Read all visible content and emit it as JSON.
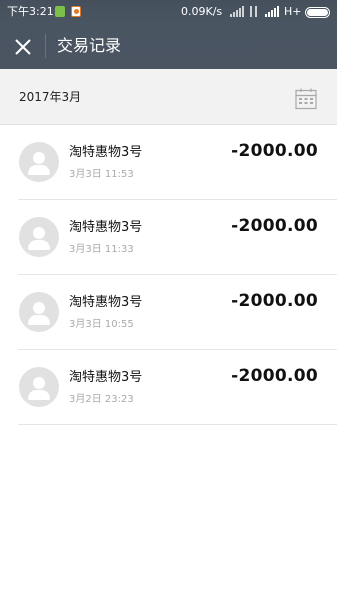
{
  "status_bar": {
    "time": "下午3:21",
    "network_speed": "0.09K/s",
    "network_type": "H+"
  },
  "header": {
    "title": "交易记录"
  },
  "month_bar": {
    "label": "2017年3月"
  },
  "transactions": [
    {
      "name": "淘特惠物3号",
      "date": "3月3日 11:53",
      "amount": "-2000.00"
    },
    {
      "name": "淘特惠物3号",
      "date": "3月3日 11:33",
      "amount": "-2000.00"
    },
    {
      "name": "淘特惠物3号",
      "date": "3月3日 10:55",
      "amount": "-2000.00"
    },
    {
      "name": "淘特惠物3号",
      "date": "3月2日 23:23",
      "amount": "-2000.00"
    }
  ],
  "icons": {
    "close": "close-icon",
    "calendar": "calendar-icon",
    "avatar": "default-avatar-icon"
  },
  "colors": {
    "header_bg": "#4a5562",
    "month_bar_bg": "#f2f2f2",
    "avatar_bg": "#e1e1e1"
  }
}
